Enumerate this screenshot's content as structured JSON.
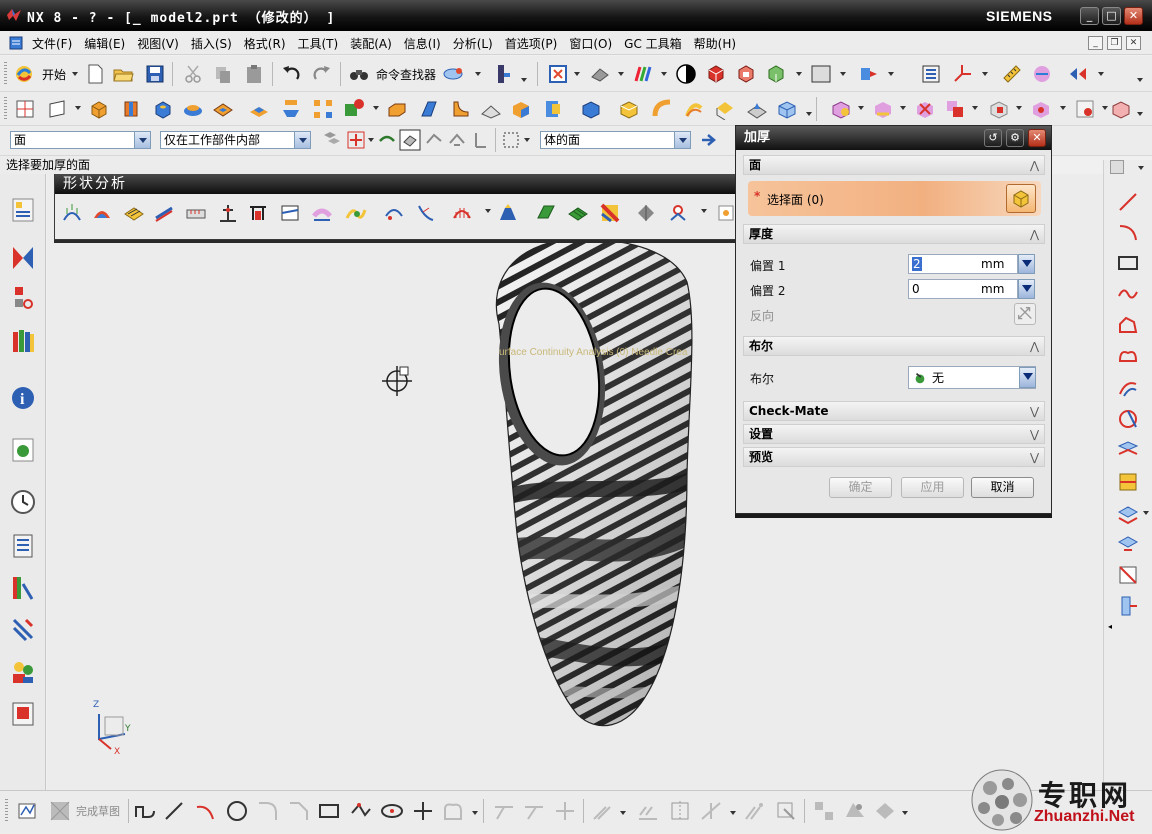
{
  "window": {
    "title": "NX 8 - ? - [_ model2.prt （修改的） ]",
    "brand": "SIEMENS",
    "controls": [
      "_",
      "□",
      "✕"
    ]
  },
  "menu": {
    "items": [
      "文件(F)",
      "编辑(E)",
      "视图(V)",
      "插入(S)",
      "格式(R)",
      "工具(T)",
      "装配(A)",
      "信息(I)",
      "分析(L)",
      "首选项(P)",
      "窗口(O)",
      "GC 工具箱",
      "帮助(H)"
    ]
  },
  "standard_toolbar": {
    "start_label": "开始",
    "command_finder_label": "命令查找器"
  },
  "selection_bar": {
    "filter_type": "面",
    "scope": "仅在工作部件内部",
    "face_rule": "体的面"
  },
  "status": {
    "prompt": "选择要加厚的面"
  },
  "shape_analysis": {
    "title": "形状分析"
  },
  "viewport": {
    "overlay_text": "urface Continuity Analysis (0) Needle Crea"
  },
  "dialog": {
    "title": "加厚",
    "sections": {
      "face": {
        "label": "面",
        "select_label": "选择面 (0)"
      },
      "thickness": {
        "label": "厚度",
        "offset1_label": "偏置 1",
        "offset1_value": "2",
        "offset1_unit": "mm",
        "offset2_label": "偏置 2",
        "offset2_value": "0",
        "offset2_unit": "mm",
        "reverse_label": "反向"
      },
      "boolean": {
        "label": "布尔",
        "field_label": "布尔",
        "value": "无"
      },
      "checkmate": {
        "label": "Check-Mate"
      },
      "settings": {
        "label": "设置"
      },
      "preview": {
        "label": "预览"
      }
    },
    "buttons": {
      "ok": "确定",
      "apply": "应用",
      "cancel": "取消"
    }
  },
  "sketch_bar": {
    "finish_label": "完成草图"
  },
  "watermark": {
    "text": "专职网",
    "url": "Zhuanzhi.Net"
  },
  "colors": {
    "select_highlight": "#f2b080",
    "titlebar": "#1a1a1a",
    "close_button": "#c8402a"
  }
}
